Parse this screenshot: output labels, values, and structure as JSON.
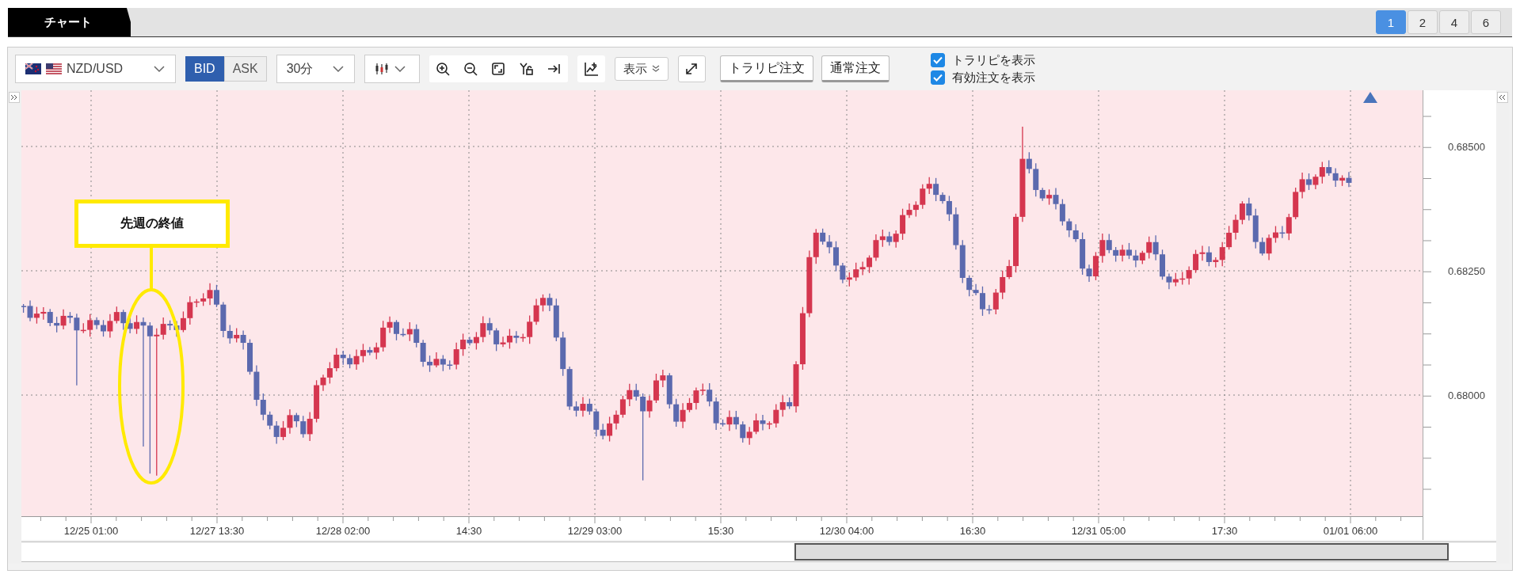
{
  "tab": {
    "label": "チャート",
    "selected": true
  },
  "layouts": [
    {
      "label": "1",
      "selected": true
    },
    {
      "label": "2",
      "selected": false
    },
    {
      "label": "4",
      "selected": false
    },
    {
      "label": "6",
      "selected": false
    }
  ],
  "toolbar": {
    "symbol": "NZD/USD",
    "price_sides": [
      {
        "label": "BID",
        "selected": true
      },
      {
        "label": "ASK",
        "selected": false
      }
    ],
    "timeframe": "30分",
    "display_button": "表示",
    "order_buttons": [
      "トラリピ注文",
      "通常注文"
    ],
    "checkboxes": [
      {
        "label": "トラリピを表示",
        "checked": true
      },
      {
        "label": "有効注文を表示",
        "checked": true
      }
    ]
  },
  "chart": {
    "callout": "先週の終値",
    "y_labels": [
      "0.68500",
      "0.68250",
      "0.68000"
    ],
    "x_labels": [
      "12/25 01:00",
      "12/27 13:30",
      "12/28 02:00",
      "14:30",
      "12/29 03:00",
      "15:30",
      "12/30 04:00",
      "16:30",
      "12/31 05:00",
      "17:30",
      "01/01 06:00"
    ]
  }
}
